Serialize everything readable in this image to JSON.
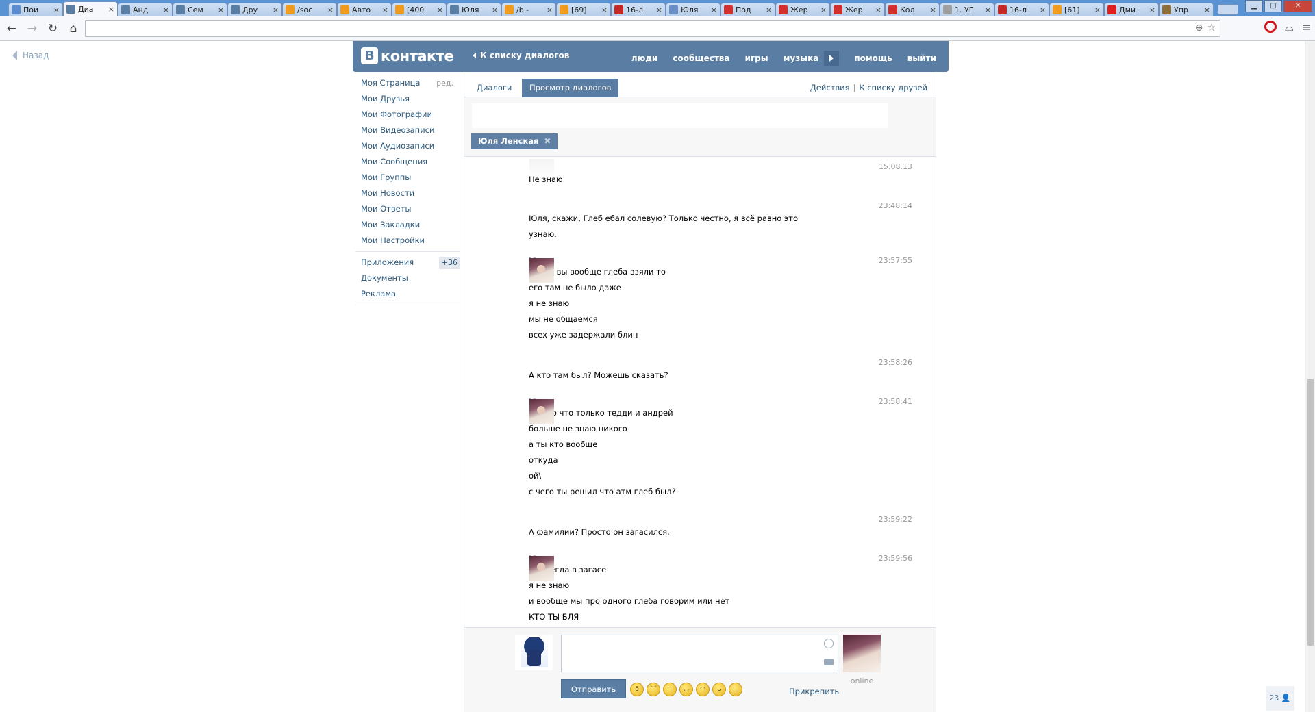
{
  "browser": {
    "tabs": [
      {
        "icon": "pause-icon",
        "title": "Пои",
        "color": "#5b8cd0"
      },
      {
        "icon": "vk-icon",
        "title": "Диа",
        "color": "#597da3",
        "active": true
      },
      {
        "icon": "vk-icon",
        "title": "Анд",
        "color": "#597da3"
      },
      {
        "icon": "vk-icon",
        "title": "Сем",
        "color": "#597da3"
      },
      {
        "icon": "vk-icon",
        "title": "Дру",
        "color": "#597da3"
      },
      {
        "icon": "bolt-icon",
        "title": "/soc",
        "color": "#f09a1e"
      },
      {
        "icon": "bolt-icon",
        "title": "Авто",
        "color": "#f09a1e"
      },
      {
        "icon": "bolt-icon",
        "title": "[400",
        "color": "#f09a1e"
      },
      {
        "icon": "vk-icon",
        "title": "Юля",
        "color": "#597da3"
      },
      {
        "icon": "bolt-icon",
        "title": "/b -",
        "color": "#f09a1e"
      },
      {
        "icon": "bolt-icon",
        "title": "[69]",
        "color": "#f09a1e"
      },
      {
        "icon": "flag-icon",
        "title": "16-л",
        "color": "#c62828"
      },
      {
        "icon": "page-icon",
        "title": "Юля",
        "color": "#6a8fc7"
      },
      {
        "icon": "l-icon",
        "title": "Под",
        "color": "#d32f2f"
      },
      {
        "icon": "l-icon",
        "title": "Жер",
        "color": "#d32f2f"
      },
      {
        "icon": "l-icon",
        "title": "Жер",
        "color": "#d32f2f"
      },
      {
        "icon": "l-icon",
        "title": "Кол",
        "color": "#d32f2f"
      },
      {
        "icon": "doc-icon",
        "title": "1. УГ",
        "color": "#9e9e9e"
      },
      {
        "icon": "flag-icon",
        "title": "16-л",
        "color": "#c62828"
      },
      {
        "icon": "bolt-icon",
        "title": "[61]",
        "color": "#f09a1e"
      },
      {
        "icon": "youtube-icon",
        "title": "Дми",
        "color": "#e02020"
      },
      {
        "icon": "globe-icon",
        "title": "Упр",
        "color": "#8d6e3a"
      }
    ],
    "address": ""
  },
  "page": {
    "back_label": "Назад"
  },
  "header": {
    "logo_text": "контакте",
    "logo_letter": "В",
    "back_to_dialogs": "К списку диалогов",
    "menu": [
      "люди",
      "сообщества",
      "игры",
      "музыка",
      "помощь",
      "выйти"
    ]
  },
  "left_nav": {
    "edit_label": "ред.",
    "items": [
      "Моя Страница",
      "Мои Друзья",
      "Мои Фотографии",
      "Мои Видеозаписи",
      "Мои Аудиозаписи",
      "Мои Сообщения",
      "Мои Группы",
      "Мои Новости",
      "Мои Ответы",
      "Мои Закладки",
      "Мои Настройки"
    ],
    "extra": [
      "Приложения",
      "Документы",
      "Реклама"
    ],
    "apps_badge": "+36"
  },
  "tabs": {
    "dialogs": "Диалоги",
    "view": "Просмотр диалогов",
    "actions": "Действия",
    "friends": "К списку друзей"
  },
  "peer": {
    "chip_label": "Юля Ленская"
  },
  "messages": [
    {
      "author": "",
      "time": "15.08.13",
      "lines": [
        "Не знаю"
      ],
      "avatar": false
    },
    {
      "author": "",
      "time": "23:48:14",
      "lines": [
        "Юля, скажи, Глеб ебал солевую? Только честно, я всё равно это",
        "узнаю."
      ],
      "avatar": false
    },
    {
      "author": "Юля",
      "time": "23:57:55",
      "lines": [
        "с чего вы вообще глеба взяли то",
        "его там не было даже",
        "я не знаю",
        "мы не общаемся",
        "всех уже задержали блин"
      ],
      "avatar": true
    },
    {
      "author": "",
      "time": "23:58:26",
      "lines": [
        "А кто там был? Можешь сказать?"
      ],
      "avatar": false
    },
    {
      "author": "Юля",
      "time": "23:58:41",
      "lines": [
        "я знаю что только тедди и андрей",
        "больше не знаю никого",
        "а ты кто вообще",
        "откуда",
        "ой\\",
        "с чего ты решил что атм глеб был?"
      ],
      "avatar": true
    },
    {
      "author": "",
      "time": "23:59:22",
      "lines": [
        "А фамилии? Просто он загасился."
      ],
      "avatar": false
    },
    {
      "author": "Юля",
      "time": "23:59:56",
      "lines": [
        "он всегда в загасе",
        "я не знаю",
        "и вообще мы про одного глеба говорим или нет",
        "КТО ТЫ БЛЯ"
      ],
      "avatar": true
    }
  ],
  "composer": {
    "send_label": "Отправить",
    "attach_label": "Прикрепить",
    "online_label": "online"
  },
  "counter": "23"
}
